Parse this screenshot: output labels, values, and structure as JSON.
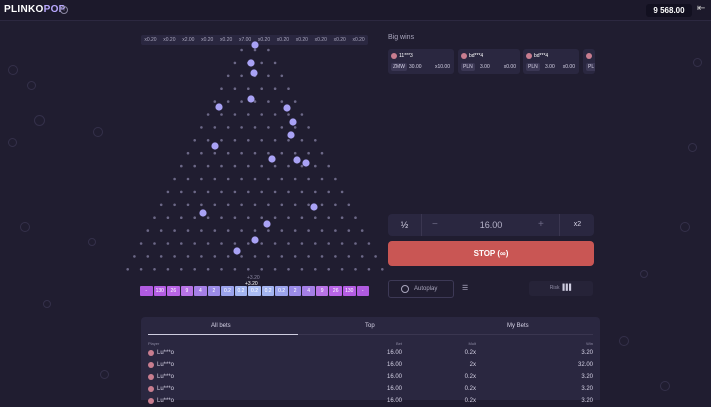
{
  "header": {
    "logo_left": "PLINKO",
    "logo_right": "POP",
    "info_icon": "info-icon",
    "balance": "9 568.00",
    "exit_icon": "exit-icon"
  },
  "board": {
    "top_multipliers": [
      "x0.20",
      "x0.20",
      "x2.00",
      "x0.20",
      "x0.20",
      "x7.00",
      "x0.20",
      "x0.20",
      "x0.20",
      "x0.20",
      "x0.20",
      "x0.20"
    ],
    "bottom_slots": [
      "-",
      "130",
      "26",
      "9",
      "4",
      "2",
      "0.2",
      "0.2",
      "0.2",
      "0.2",
      "0.2",
      "2",
      "4",
      "9",
      "26",
      "130",
      "-"
    ],
    "slot_colors": [
      "#b05be0",
      "#b45de3",
      "#b865e6",
      "#b873e6",
      "#a57fe6",
      "#9b8ce8",
      "#9ba3ec",
      "#a3b4f0",
      "#aabcf4",
      "#a3b4f0",
      "#9ba3ec",
      "#9b8ce8",
      "#a57fe6",
      "#b873e6",
      "#b865e6",
      "#b45de3",
      "#b05be0"
    ],
    "win_label_top": "+3.20",
    "win_label": "+3.20",
    "peg_color": "#6c6887",
    "ball_color": "#a9a2f5"
  },
  "big_wins": {
    "title": "Big wins",
    "cards": [
      {
        "name": "11***3",
        "currency": "ZMW",
        "amount": "30.00",
        "multiplier": "x10.00"
      },
      {
        "name": "bd***4",
        "currency": "PLN",
        "amount": "3.00",
        "multiplier": "x0.00"
      },
      {
        "name": "bd***4",
        "currency": "PLN",
        "amount": "3.00",
        "multiplier": "x0.00"
      },
      {
        "name": "",
        "currency": "PL",
        "amount": "",
        "multiplier": ""
      }
    ]
  },
  "controls": {
    "half": "½",
    "minus": "−",
    "bet_value": "16.00",
    "plus": "+",
    "double": "x2",
    "stop_label": "STOP (∞)",
    "autoplay_label": "Autoplay",
    "risk_label": "Risk",
    "risk_bars": "▌▌▌"
  },
  "bets_table": {
    "tabs": [
      "All bets",
      "Top",
      "My Bets"
    ],
    "columns": [
      "Player",
      "Bet",
      "Mult",
      "Win"
    ],
    "rows": [
      {
        "player": "Lu***o",
        "bet": "16.00",
        "mult": "0.2x",
        "win": "3.20"
      },
      {
        "player": "Lu***o",
        "bet": "16.00",
        "mult": "2x",
        "win": "32.00"
      },
      {
        "player": "Lu***o",
        "bet": "16.00",
        "mult": "0.2x",
        "win": "3.20"
      },
      {
        "player": "Lu***o",
        "bet": "16.00",
        "mult": "0.2x",
        "win": "3.20"
      },
      {
        "player": "Lu***o",
        "bet": "16.00",
        "mult": "0.2x",
        "win": "3.20"
      }
    ]
  }
}
